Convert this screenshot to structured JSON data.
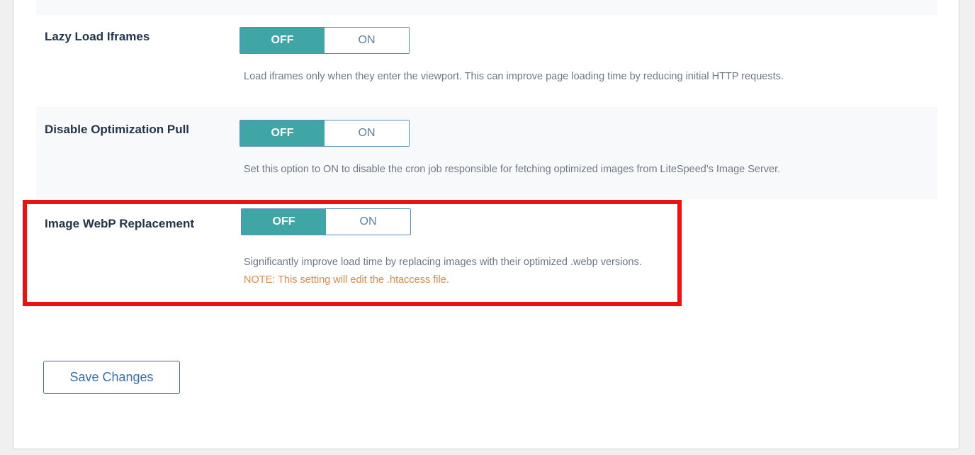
{
  "settings": [
    {
      "label": "Lazy Load Iframes",
      "toggle": {
        "off_label": "OFF",
        "on_label": "ON",
        "state": "OFF"
      },
      "description": "Load iframes only when they enter the viewport. This can improve page loading time by reducing initial HTTP requests."
    },
    {
      "label": "Disable Optimization Pull",
      "toggle": {
        "off_label": "OFF",
        "on_label": "ON",
        "state": "OFF"
      },
      "description": "Set this option to ON to disable the cron job responsible for fetching optimized images from LiteSpeed's Image Server."
    },
    {
      "label": "Image WebP Replacement",
      "toggle": {
        "off_label": "OFF",
        "on_label": "ON",
        "state": "OFF"
      },
      "description": "Significantly improve load time by replacing images with their optimized .webp versions.",
      "note": "NOTE: This setting will edit the .htaccess file."
    }
  ],
  "save_button": {
    "label": "Save Changes"
  },
  "colors": {
    "toggle_active": "#3fa6a5",
    "highlight_border": "#ee1111",
    "note_text": "#e0894a",
    "label_text": "#23354a"
  }
}
